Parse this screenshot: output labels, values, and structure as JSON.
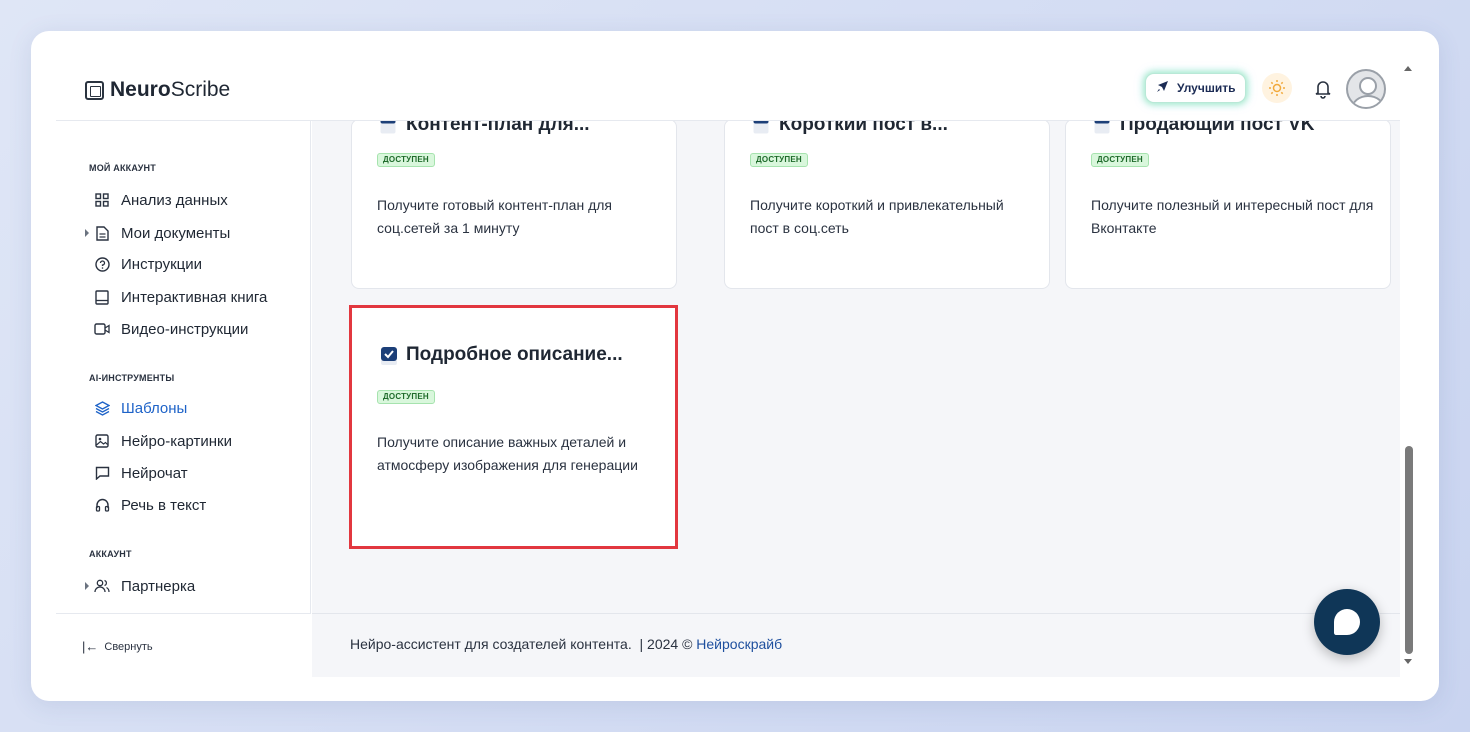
{
  "header": {
    "logo_bold": "Neuro",
    "logo_light": "Scribe",
    "upgrade_label": "Улучшить",
    "theme_icon": "sun-icon",
    "notifications_icon": "bell-icon",
    "avatar_icon": "user-avatar-icon"
  },
  "sidebar": {
    "sections": [
      {
        "title": "МОЙ АККАУНТ",
        "items": [
          {
            "label": "Анализ данных",
            "icon": "grid-icon"
          },
          {
            "label": "Мои документы",
            "icon": "document-icon"
          },
          {
            "label": "Инструкции",
            "icon": "help-circle-icon"
          },
          {
            "label": "Интерактивная книга",
            "icon": "book-icon"
          },
          {
            "label": "Видео-инструкции",
            "icon": "video-icon"
          }
        ]
      },
      {
        "title": "AI-ИНСТРУМЕНТЫ",
        "items": [
          {
            "label": "Шаблоны",
            "icon": "layers-icon",
            "active": true
          },
          {
            "label": "Нейро-картинки",
            "icon": "image-icon"
          },
          {
            "label": "Нейрочат",
            "icon": "chat-icon"
          },
          {
            "label": "Речь в текст",
            "icon": "headphones-icon"
          }
        ]
      },
      {
        "title": "АККАУНТ",
        "items": [
          {
            "label": "Партнерка",
            "icon": "users-icon"
          }
        ]
      }
    ],
    "collapse_label": "Свернуть"
  },
  "cards": [
    {
      "title": "Контент-план для...",
      "badge": "ДОСТУПЕН",
      "description": "Получите готовый контент-план для соц.сетей за 1 минуту"
    },
    {
      "title": "Короткий пост в...",
      "badge": "ДОСТУПЕН",
      "description": "Получите короткий и привлекательный пост в соц.сеть"
    },
    {
      "title": "Продающий пост VK",
      "badge": "ДОСТУПЕН",
      "description": "Получите полезный и интересный пост для Вконтакте"
    },
    {
      "title": "Подробное описание...",
      "badge": "ДОСТУПЕН",
      "description": "Получите описание важных деталей и атмосферу изображения для генерации",
      "highlighted": true
    }
  ],
  "footer": {
    "text": "Нейро-ассистент для создателей контента.  | 2024 © ",
    "link": "Нейроскрайб"
  },
  "colors": {
    "accent": "#1e63c8",
    "highlight": "#e2373f",
    "badge_bg": "#d9f7dc",
    "chat_button": "#0f3657"
  }
}
